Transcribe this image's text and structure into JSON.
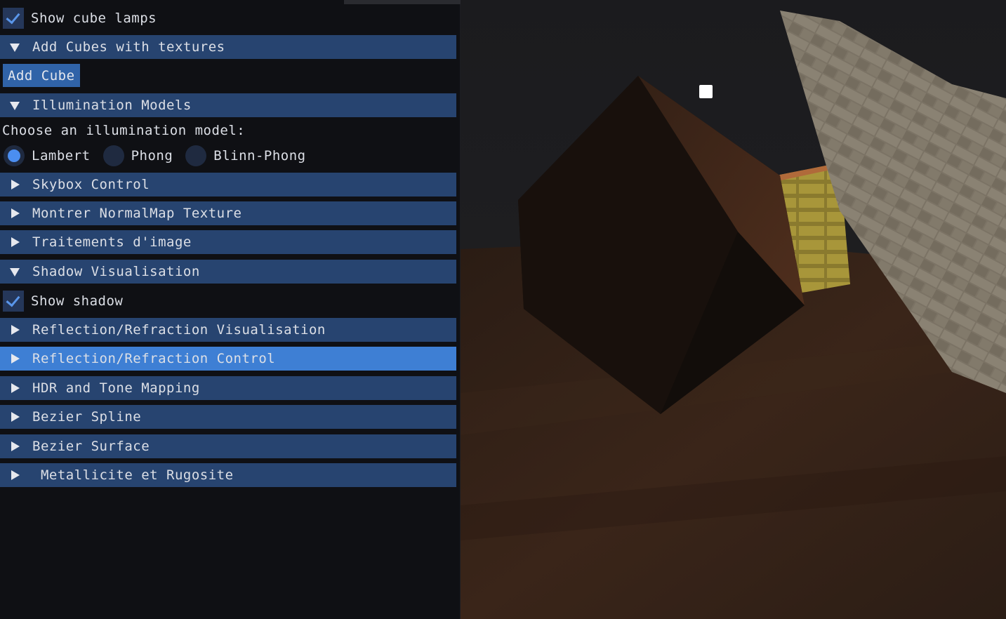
{
  "panel": {
    "show_cube_lamps": {
      "label": "Show cube lamps",
      "checked": true
    },
    "add_cubes_header": {
      "label": "Add Cubes with textures",
      "expanded": true
    },
    "add_cube_button": "Add Cube",
    "illumination_header": {
      "label": "Illumination Models",
      "expanded": true
    },
    "illumination_prompt": "Choose an illumination model:",
    "illumination_options": [
      {
        "label": "Lambert",
        "selected": true
      },
      {
        "label": "Phong",
        "selected": false
      },
      {
        "label": "Blinn-Phong",
        "selected": false
      }
    ],
    "skybox_header": "Skybox Control",
    "normalmap_header": "Montrer NormalMap Texture",
    "image_processing_header": "Traitements d'image",
    "shadow_header": {
      "label": "Shadow Visualisation",
      "expanded": true
    },
    "show_shadow": {
      "label": "Show shadow",
      "checked": true
    },
    "reflection_vis_header": "Reflection/Refraction Visualisation",
    "reflection_ctrl_header": "Reflection/Refraction Control",
    "hdr_header": "HDR and Tone Mapping",
    "bezier_spline_header": "Bezier Spline",
    "bezier_surface_header": "Bezier Surface",
    "metal_header": " Metallicite et Rugosite"
  },
  "colors": {
    "panel_bg": "#0f1014",
    "header_bg": "#274470",
    "header_active_bg": "#3e7fd4",
    "button_bg": "#3063a8",
    "check_color": "#5a96ea"
  }
}
